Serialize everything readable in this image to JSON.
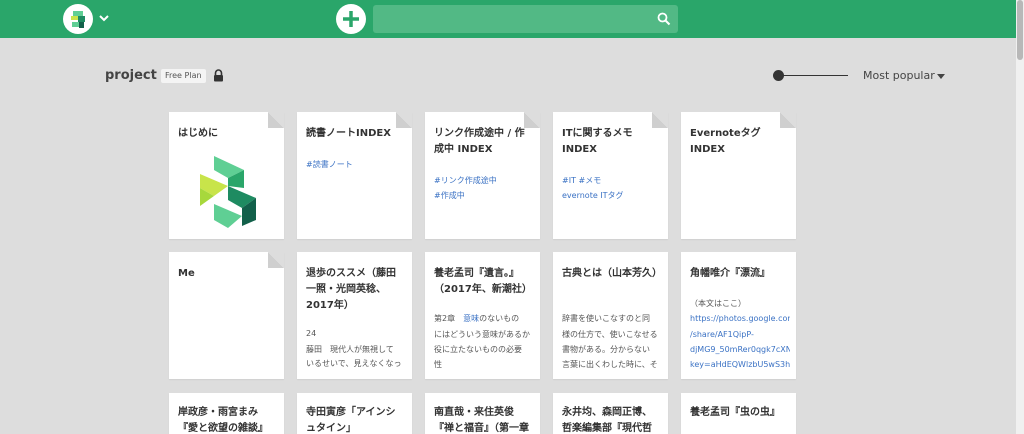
{
  "header": {
    "search": {
      "value": "",
      "placeholder": ""
    }
  },
  "project": {
    "title": "project",
    "plan": "Free Plan"
  },
  "sort": {
    "label": "Most popular"
  },
  "slider": {
    "level": 0
  },
  "cards": {
    "c1": {
      "title": "はじめに"
    },
    "c2": {
      "title": "読書ノートINDEX",
      "tags": "#読書ノート"
    },
    "c3": {
      "title": "リンク作成途中 / 作成中 INDEX",
      "tag1": "#リンク作成途中",
      "tag2": "#作成中"
    },
    "c4": {
      "title": "ITに関するメモ INDEX",
      "tags": "#IT #メモ",
      "tag2": "evernote ITタグ"
    },
    "c5": {
      "title": "EvernoteタグINDEX"
    },
    "c6": {
      "title": "Me"
    },
    "c7": {
      "title": "退歩のススメ（藤田一照・光岡英稔、2017年）",
      "line1": "24",
      "line2": "藤田　現代人が無視して",
      "line3": "いるせいで、見えなくなっ"
    },
    "c8": {
      "title": "養老孟司『遺言。』（2017年、新潮社）",
      "line1a": "第2章　",
      "line1b": "意味",
      "line1c": "のないもの",
      "line2": "にはどういう意味があるか",
      "line3": "役に立たないものの必要",
      "line4": "性"
    },
    "c9": {
      "title": "古典とは（山本芳久）",
      "line1": "辞書を使いこなすのと同",
      "line2": "様の仕方で、使いこなせる",
      "line3": "書物がある。分からない",
      "line4": "言葉に出くわした時に、そ"
    },
    "c10": {
      "title": "角幡唯介『漂流』",
      "line1": "（本文はここ）",
      "link1": "https://photos.google.com",
      "link2": "/share/AF1QipP-",
      "link3": "djMG9_50mRer0qgk7cXN",
      "link4": "key=aHdEQWlzbU5wS3hC"
    },
    "c11": {
      "title": "岸政彦・雨宮まみ『愛と欲望の雑談』"
    },
    "c12": {
      "title": "寺田寅彦「アインシュタイン」"
    },
    "c13": {
      "title": "南直哉・来住英俊『禅と福音』（第一章"
    },
    "c14": {
      "title": "永井均、森岡正博、哲楽編集部『現代哲"
    },
    "c15": {
      "title": "養老孟司『虫の虫』"
    }
  },
  "colors": {
    "header": "#2aa66a",
    "search": "#52b985",
    "link": "#3b72c4",
    "background": "#dddddd"
  },
  "icons": [
    "scrapbox-logo-icon",
    "chevron-down-icon",
    "plus-icon",
    "search-icon",
    "lock-icon",
    "page-fold-icon"
  ]
}
